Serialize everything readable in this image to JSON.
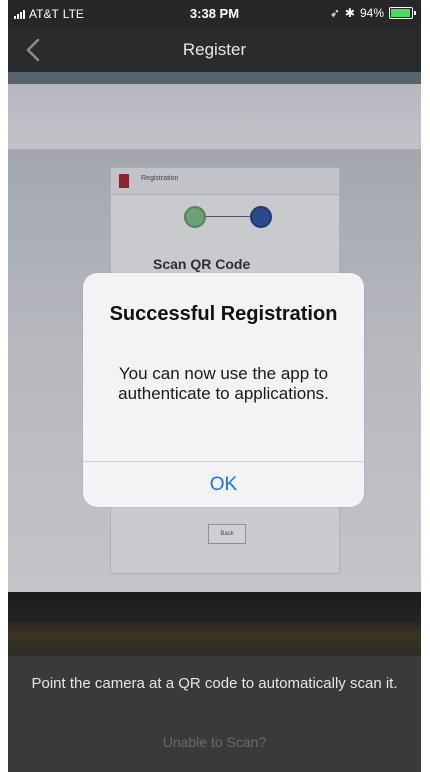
{
  "status_bar": {
    "carrier": "AT&T",
    "network": "LTE",
    "time": "3:38 PM",
    "battery": "94%",
    "battery_level": 0.94
  },
  "nav": {
    "title": "Register",
    "back_icon": "chevron-left-icon"
  },
  "camera_preview": {
    "card_header": "Registration",
    "heading": "Scan QR Code",
    "steps": [
      "1",
      "2"
    ],
    "back_label": "Back"
  },
  "alert": {
    "title": "Successful Registration",
    "message": "You can now use the app to authenticate to applications.",
    "ok_label": "OK"
  },
  "bottom": {
    "instruction": "Point the camera at a QR code to automatically scan it.",
    "unable_link": "Unable to Scan?"
  },
  "colors": {
    "accent": "#1a73e8",
    "battery_green": "#4cd964",
    "step_done": "#6f9f76",
    "step_active": "#2a4a8a"
  }
}
